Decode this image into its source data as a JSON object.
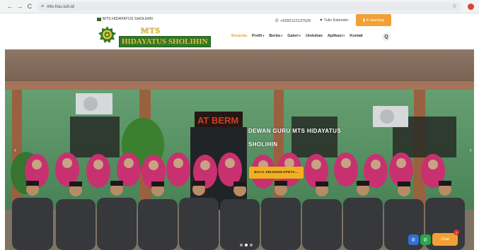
{
  "browser": {
    "back_icon": "←",
    "forward_icon": "→",
    "reload_icon": "C",
    "tune_icon": "≡",
    "url": "mts-hsu.sch.id",
    "star_icon": "☆"
  },
  "header": {
    "small_brand": "MTS HIDAYATUS SHOLIHIN",
    "brand_line1": "MTS",
    "brand_line2": "HIDAYATUS SHOLIHIN",
    "phone_icon": "✆",
    "phone": "+6282122137528",
    "calendar_icon": "♥",
    "calendar_label": "Tulis Kalender",
    "elearning_icon": "▮",
    "elearning_label": "E-learning",
    "search_icon": "Q"
  },
  "menu": {
    "items": [
      {
        "label": "Beranda",
        "active": true,
        "dropdown": false
      },
      {
        "label": "Profil",
        "active": false,
        "dropdown": true
      },
      {
        "label": "Berita",
        "active": false,
        "dropdown": true
      },
      {
        "label": "Galeri",
        "active": false,
        "dropdown": true
      },
      {
        "label": "Unduhan",
        "active": false,
        "dropdown": false
      },
      {
        "label": "Aplikasi",
        "active": false,
        "dropdown": true
      },
      {
        "label": "Kontak",
        "active": false,
        "dropdown": false
      }
    ],
    "caret": "▾"
  },
  "hero": {
    "title": "DEWAN GURU MTS HIDAYATUS SHOLIHIN",
    "button_label": "BACA SELENGKAPNYA...",
    "sign_text": "AT BERM",
    "prev_icon": "‹",
    "next_icon": "›",
    "slides_total": 3,
    "slide_active": 1
  },
  "floating": {
    "phone_icon": "✆",
    "whatsapp_icon": "✆",
    "chat_label": "Chat",
    "badge_count": "1"
  },
  "colors": {
    "accent": "#f2a033",
    "brand_green": "#2f7a28",
    "brand_gold": "#e8c23b",
    "hero_button": "#f2b01f"
  }
}
